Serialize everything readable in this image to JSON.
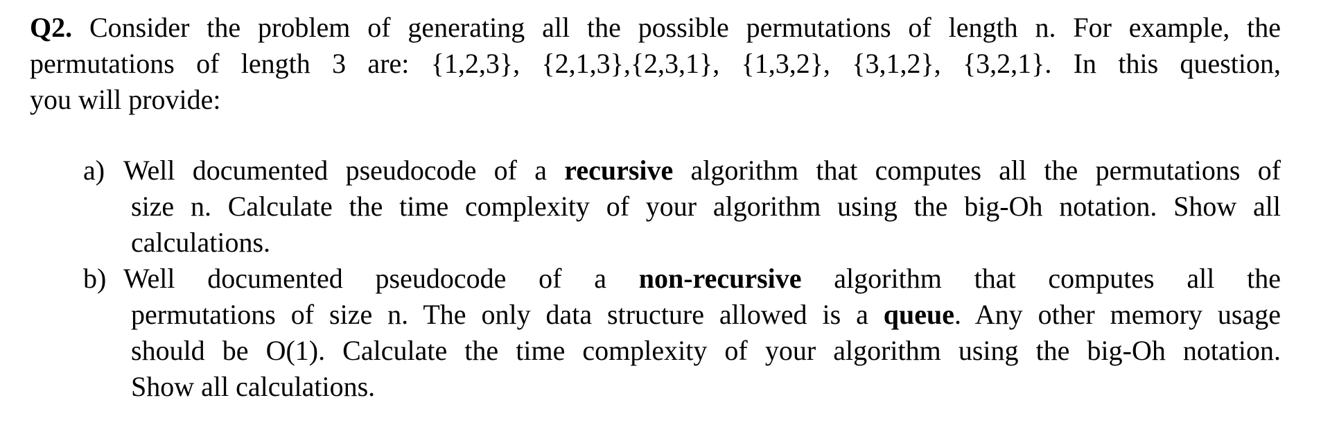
{
  "question": {
    "label": "Q2.",
    "intro_lines": [
      "Consider the problem of generating all the possible permutations of length n. For example, the",
      "permutations of length 3 are: {1,2,3}, {2,1,3},{2,3,1}, {1,3,2}, {3,1,2}, {3,2,1}.  In this question,",
      "you will provide:"
    ]
  },
  "parts": [
    {
      "marker": "a)",
      "line1_pre": "Well documented pseudocode of a ",
      "line1_bold": "recursive",
      "line1_post": " algorithm that computes all the permutations of",
      "line2": "size n. Calculate the time complexity of your algorithm using the big-Oh notation. Show all",
      "line3": "calculations."
    },
    {
      "marker": "b)",
      "line1_pre": "Well documented pseudocode of a ",
      "line1_bold": "non-recursive",
      "line1_post": " algorithm that computes all the",
      "line2_pre": "permutations of size n. The only data structure allowed is a ",
      "line2_bold": "queue",
      "line2_post": ". Any other memory usage",
      "line3": "should be O(1). Calculate the time complexity of your algorithm using the big-Oh notation.",
      "line4": "Show all calculations."
    }
  ]
}
